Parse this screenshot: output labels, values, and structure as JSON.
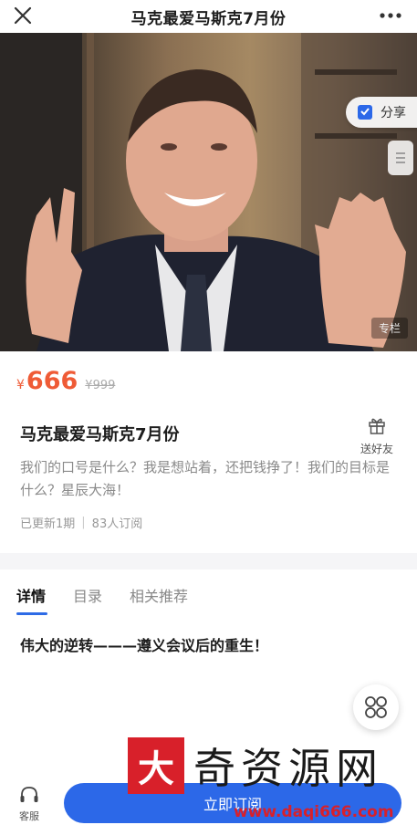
{
  "header": {
    "title": "马克最爱马斯克7月份"
  },
  "hero": {
    "share_label": "分享",
    "column_tag": "专栏"
  },
  "product": {
    "currency": "¥",
    "price": "666",
    "original_price": "¥999",
    "title": "马克最爱马斯克7月份",
    "gift_label": "送好友",
    "description": "我们的口号是什么？我是想站着，还把钱挣了！我们的目标是什么？星辰大海！",
    "updates": "已更新1期",
    "subscribers": "83人订阅"
  },
  "tabs": [
    {
      "label": "详情"
    },
    {
      "label": "目录"
    },
    {
      "label": "相关推荐"
    }
  ],
  "content": {
    "heading": "伟大的逆转———遵义会议后的重生！"
  },
  "bottom": {
    "service_label": "客服",
    "subscribe_label": "立即订阅"
  },
  "watermark": {
    "logo_char": "大",
    "text": "奇资源网",
    "url": "www.daqi666.com"
  },
  "colors": {
    "accent": "#2c68e8",
    "price": "#ef5b36",
    "watermark": "#d8202a"
  }
}
